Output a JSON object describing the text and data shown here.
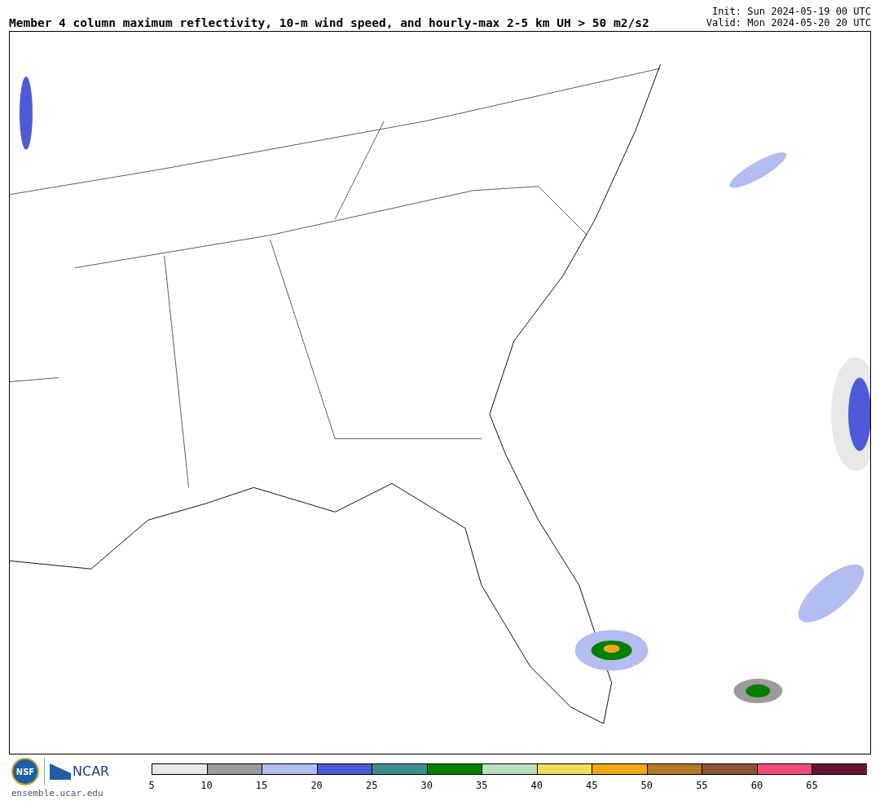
{
  "title": "Member 4 column maximum reflectivity, 10-m wind speed, and hourly-max 2-5 km UH > 50 m2/s2",
  "init": "Init: Sun 2024-05-19 00 UTC",
  "valid": "Valid: Mon 2024-05-20 20 UTC",
  "logos": {
    "nsf": "NSF",
    "ncar": "NCAR",
    "site": "ensemble.ucar.edu"
  },
  "colorbar": {
    "bins": [
      {
        "color": "#e8e8e8"
      },
      {
        "color": "#9b9b9b"
      },
      {
        "color": "#b4bdf0"
      },
      {
        "color": "#4e5ad8"
      },
      {
        "color": "#3f8c8f"
      },
      {
        "color": "#008000"
      },
      {
        "color": "#b8e0bc"
      },
      {
        "color": "#f0dc5a"
      },
      {
        "color": "#f0a814"
      },
      {
        "color": "#b07828"
      },
      {
        "color": "#8c5438"
      },
      {
        "color": "#f04c78"
      },
      {
        "color": "#641432"
      }
    ],
    "labels": [
      "5",
      "10",
      "15",
      "20",
      "25",
      "30",
      "35",
      "40",
      "45",
      "50",
      "55",
      "60",
      "65"
    ]
  }
}
